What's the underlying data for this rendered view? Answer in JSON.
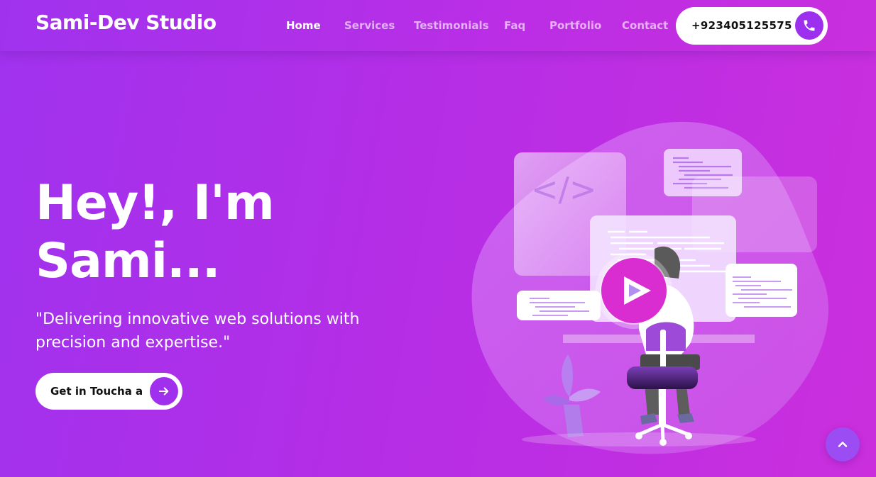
{
  "nav": {
    "brand": "Sami-Dev Studio",
    "links": [
      {
        "label": "Home",
        "active": true
      },
      {
        "label": "Services"
      },
      {
        "label": "Testimonials"
      },
      {
        "label": "Faq"
      },
      {
        "label": "Portfolio"
      },
      {
        "label": "Contact"
      }
    ],
    "phone": "+923405125575",
    "phone_icon": "phone-icon"
  },
  "hero": {
    "title_line1": "Hey!, I'm",
    "title_line2": "Sami...",
    "subtitle": "\"Delivering innovative web solutions with precision and expertise.\"",
    "cta_label": "Get in Toucha a",
    "cta_icon": "arrow-right-icon",
    "code_symbol": "</>"
  },
  "illustration": {
    "play_icon": "play-icon"
  },
  "scroll_top_icon": "chevron-up-icon",
  "colors": {
    "brand_purple": "#a032ee",
    "accent_magenta": "#d02fe0",
    "white": "#ffffff"
  }
}
